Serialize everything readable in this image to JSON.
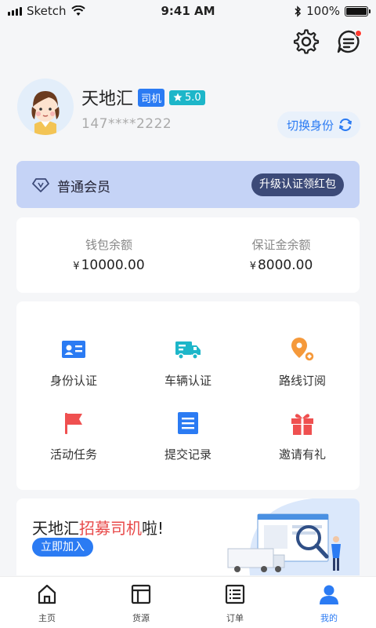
{
  "status_bar": {
    "carrier": "Sketch",
    "time": "9:41 AM",
    "battery": "100%",
    "battery_level": 1.0
  },
  "header": {
    "icons": [
      "gear-icon",
      "message-icon"
    ],
    "message_has_dot": true
  },
  "profile": {
    "name": "天地汇",
    "role_badge": "司机",
    "rating": "5.0",
    "phone": "147****2222",
    "switch_label": "切换身份"
  },
  "membership": {
    "label": "普通会员",
    "upgrade_label": "升级认证领红包"
  },
  "wallet": {
    "balance_label": "钱包余额",
    "balance_currency": "¥",
    "balance_value": "10000.00",
    "deposit_label": "保证金余额",
    "deposit_currency": "¥",
    "deposit_value": "8000.00"
  },
  "features": [
    {
      "label": "身份认证",
      "icon": "id-card-icon",
      "color": "#2b7bf3"
    },
    {
      "label": "车辆认证",
      "icon": "truck-icon",
      "color": "#1db6c9"
    },
    {
      "label": "路线订阅",
      "icon": "route-pin-icon",
      "color": "#f5993a"
    },
    {
      "label": "活动任务",
      "icon": "flag-icon",
      "color": "#ef5050"
    },
    {
      "label": "提交记录",
      "icon": "document-icon",
      "color": "#2b7bf3"
    },
    {
      "label": "邀请有礼",
      "icon": "gift-icon",
      "color": "#ef5050"
    }
  ],
  "banner": {
    "title_prefix": "天地汇",
    "title_highlight": "招募司机",
    "title_suffix": "啦!",
    "join_label": "立即加入"
  },
  "tabbar": [
    {
      "label": "主页",
      "icon": "home-icon",
      "active": false
    },
    {
      "label": "货源",
      "icon": "cargo-layout-icon",
      "active": false
    },
    {
      "label": "订单",
      "icon": "order-list-icon",
      "active": false
    },
    {
      "label": "我的",
      "icon": "user-icon",
      "active": true
    }
  ],
  "colors": {
    "accent": "#2b7bf3",
    "member_bg": "#c5d3f6",
    "upgrade_bg": "#3c4a78",
    "highlight": "#e84a4a"
  }
}
